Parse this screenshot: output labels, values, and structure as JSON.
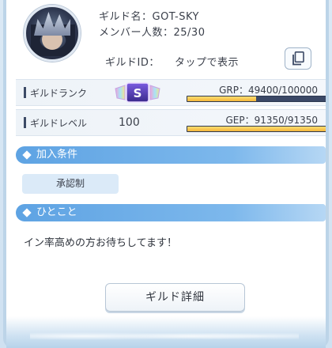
{
  "guild": {
    "name_line": "ギルド名：GOT-SKY",
    "members_line": "メンバー人数：25/30",
    "id_label": "ギルドID：",
    "id_value": "タップで表示"
  },
  "stats": {
    "rank": {
      "label": "ギルドランク",
      "badge_letter": "S",
      "gauge_text": "GRP：49400/100000",
      "progress": 0.494
    },
    "level": {
      "label": "ギルドレベル",
      "value": "100",
      "gauge_text": "GEP：91350/91350",
      "progress": 1.0
    }
  },
  "sections": {
    "conditions_title": "加入条件",
    "condition_value": "承認制",
    "comment_title": "ひとこと",
    "comment_text": "イン率高めの方お待ちしてます！"
  },
  "actions": {
    "detail_button": "ギルド詳細"
  },
  "icons": {
    "copy": "copy-icon",
    "avatar": "guild-avatar"
  },
  "colors": {
    "accent": "#5ea3e3",
    "gauge_fill": "#f2b43a",
    "gauge_bg": "#3b4866"
  }
}
